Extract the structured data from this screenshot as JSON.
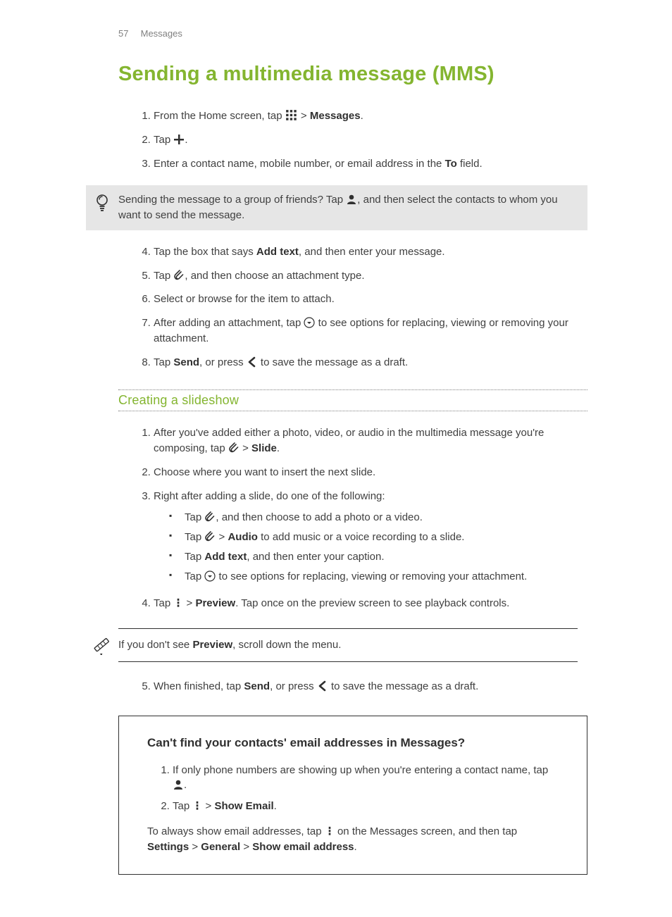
{
  "header": {
    "page_number": "57",
    "section": "Messages"
  },
  "title": "Sending a multimedia message (MMS)",
  "steps_a": {
    "s1": {
      "before": "From the Home screen, tap ",
      "bold": "Messages",
      "after": "."
    },
    "s2": {
      "before": "Tap ",
      "after": "."
    },
    "s3": {
      "before": "Enter a contact name, mobile number, or email address in the ",
      "bold": "To",
      "after": " field."
    }
  },
  "callout_tip": {
    "before": "Sending the message to a group of friends? Tap ",
    "after": ", and then select the contacts to whom you want to send the message."
  },
  "steps_b": {
    "s4": {
      "before": "Tap the box that says ",
      "bold": "Add text",
      "after": ", and then enter your message."
    },
    "s5": {
      "before": "Tap ",
      "after": ", and then choose an attachment type."
    },
    "s6": "Select or browse for the item to attach.",
    "s7": {
      "before": "After adding an attachment, tap ",
      "after": " to see options for replacing, viewing or removing your attachment."
    },
    "s8": {
      "before": "Tap ",
      "bold": "Send",
      "mid": ", or press ",
      "after": " to save the message as a draft."
    }
  },
  "subhead1": "Creating a slideshow",
  "slideshow": {
    "s1": {
      "before": "After you've added either a photo, video, or audio in the multimedia message you're composing, tap ",
      "bold": "Slide",
      "after": "."
    },
    "s2": "Choose where you want to insert the next slide.",
    "s3": "Right after adding a slide, do one of the following:",
    "s3_bullets": {
      "b1": {
        "before": "Tap ",
        "after": ", and then choose to add a photo or a video."
      },
      "b2": {
        "before": "Tap ",
        "bold": "Audio",
        "after": " to add music or a voice recording to a slide."
      },
      "b3": {
        "before": "Tap ",
        "bold": "Add text",
        "after": ", and then enter your caption."
      },
      "b4": {
        "before": "Tap ",
        "after": " to see options for replacing, viewing or removing your attachment."
      }
    },
    "s4": {
      "before": "Tap ",
      "bold": "Preview",
      "after": ". Tap once on the preview screen to see playback controls."
    }
  },
  "note_preview": {
    "before": "If you don't see ",
    "bold": "Preview",
    "after": ", scroll down the menu."
  },
  "slideshow2": {
    "s5": {
      "before": "When finished, tap ",
      "bold": "Send",
      "mid": ", or press ",
      "after": " to save the message as a draft."
    }
  },
  "panel": {
    "title": "Can't find your contacts' email addresses in Messages?",
    "s1": {
      "before": "If only phone numbers are showing up when you're entering a contact name, tap ",
      "after": "."
    },
    "s2": {
      "before": "Tap ",
      "bold": "Show Email",
      "after": "."
    },
    "post": {
      "before": "To always show email addresses, tap ",
      "mid1": " on the Messages screen, and then tap ",
      "b1": "Settings",
      "gt1": " > ",
      "b2": "General",
      "gt2": " > ",
      "b3": "Show email address",
      "after": "."
    }
  }
}
